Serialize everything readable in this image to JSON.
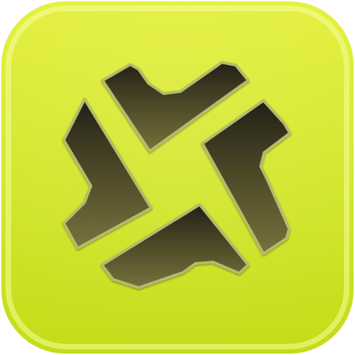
{
  "app_icon": {
    "icon_name": "four-blade-pinwheel-logo",
    "colors": {
      "background_top": "#e4f040",
      "background_bottom": "#c4dc18",
      "rim_highlight": "#f6ff9a",
      "glyph_dark": "#222018",
      "glyph_mid": "#4e4a28",
      "glyph_light": "#78723c",
      "glyph_outline": "#b4bc6a"
    }
  }
}
